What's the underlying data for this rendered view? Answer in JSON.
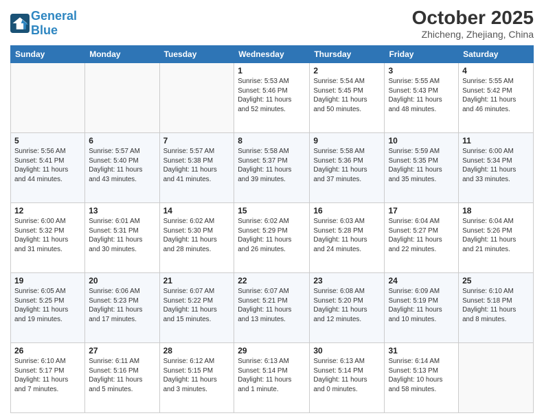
{
  "logo": {
    "text_general": "General",
    "text_blue": "Blue"
  },
  "title": "October 2025",
  "location": "Zhicheng, Zhejiang, China",
  "days_of_week": [
    "Sunday",
    "Monday",
    "Tuesday",
    "Wednesday",
    "Thursday",
    "Friday",
    "Saturday"
  ],
  "weeks": [
    [
      {
        "day": "",
        "info": ""
      },
      {
        "day": "",
        "info": ""
      },
      {
        "day": "",
        "info": ""
      },
      {
        "day": "1",
        "info": "Sunrise: 5:53 AM\nSunset: 5:46 PM\nDaylight: 11 hours\nand 52 minutes."
      },
      {
        "day": "2",
        "info": "Sunrise: 5:54 AM\nSunset: 5:45 PM\nDaylight: 11 hours\nand 50 minutes."
      },
      {
        "day": "3",
        "info": "Sunrise: 5:55 AM\nSunset: 5:43 PM\nDaylight: 11 hours\nand 48 minutes."
      },
      {
        "day": "4",
        "info": "Sunrise: 5:55 AM\nSunset: 5:42 PM\nDaylight: 11 hours\nand 46 minutes."
      }
    ],
    [
      {
        "day": "5",
        "info": "Sunrise: 5:56 AM\nSunset: 5:41 PM\nDaylight: 11 hours\nand 44 minutes."
      },
      {
        "day": "6",
        "info": "Sunrise: 5:57 AM\nSunset: 5:40 PM\nDaylight: 11 hours\nand 43 minutes."
      },
      {
        "day": "7",
        "info": "Sunrise: 5:57 AM\nSunset: 5:38 PM\nDaylight: 11 hours\nand 41 minutes."
      },
      {
        "day": "8",
        "info": "Sunrise: 5:58 AM\nSunset: 5:37 PM\nDaylight: 11 hours\nand 39 minutes."
      },
      {
        "day": "9",
        "info": "Sunrise: 5:58 AM\nSunset: 5:36 PM\nDaylight: 11 hours\nand 37 minutes."
      },
      {
        "day": "10",
        "info": "Sunrise: 5:59 AM\nSunset: 5:35 PM\nDaylight: 11 hours\nand 35 minutes."
      },
      {
        "day": "11",
        "info": "Sunrise: 6:00 AM\nSunset: 5:34 PM\nDaylight: 11 hours\nand 33 minutes."
      }
    ],
    [
      {
        "day": "12",
        "info": "Sunrise: 6:00 AM\nSunset: 5:32 PM\nDaylight: 11 hours\nand 31 minutes."
      },
      {
        "day": "13",
        "info": "Sunrise: 6:01 AM\nSunset: 5:31 PM\nDaylight: 11 hours\nand 30 minutes."
      },
      {
        "day": "14",
        "info": "Sunrise: 6:02 AM\nSunset: 5:30 PM\nDaylight: 11 hours\nand 28 minutes."
      },
      {
        "day": "15",
        "info": "Sunrise: 6:02 AM\nSunset: 5:29 PM\nDaylight: 11 hours\nand 26 minutes."
      },
      {
        "day": "16",
        "info": "Sunrise: 6:03 AM\nSunset: 5:28 PM\nDaylight: 11 hours\nand 24 minutes."
      },
      {
        "day": "17",
        "info": "Sunrise: 6:04 AM\nSunset: 5:27 PM\nDaylight: 11 hours\nand 22 minutes."
      },
      {
        "day": "18",
        "info": "Sunrise: 6:04 AM\nSunset: 5:26 PM\nDaylight: 11 hours\nand 21 minutes."
      }
    ],
    [
      {
        "day": "19",
        "info": "Sunrise: 6:05 AM\nSunset: 5:25 PM\nDaylight: 11 hours\nand 19 minutes."
      },
      {
        "day": "20",
        "info": "Sunrise: 6:06 AM\nSunset: 5:23 PM\nDaylight: 11 hours\nand 17 minutes."
      },
      {
        "day": "21",
        "info": "Sunrise: 6:07 AM\nSunset: 5:22 PM\nDaylight: 11 hours\nand 15 minutes."
      },
      {
        "day": "22",
        "info": "Sunrise: 6:07 AM\nSunset: 5:21 PM\nDaylight: 11 hours\nand 13 minutes."
      },
      {
        "day": "23",
        "info": "Sunrise: 6:08 AM\nSunset: 5:20 PM\nDaylight: 11 hours\nand 12 minutes."
      },
      {
        "day": "24",
        "info": "Sunrise: 6:09 AM\nSunset: 5:19 PM\nDaylight: 11 hours\nand 10 minutes."
      },
      {
        "day": "25",
        "info": "Sunrise: 6:10 AM\nSunset: 5:18 PM\nDaylight: 11 hours\nand 8 minutes."
      }
    ],
    [
      {
        "day": "26",
        "info": "Sunrise: 6:10 AM\nSunset: 5:17 PM\nDaylight: 11 hours\nand 7 minutes."
      },
      {
        "day": "27",
        "info": "Sunrise: 6:11 AM\nSunset: 5:16 PM\nDaylight: 11 hours\nand 5 minutes."
      },
      {
        "day": "28",
        "info": "Sunrise: 6:12 AM\nSunset: 5:15 PM\nDaylight: 11 hours\nand 3 minutes."
      },
      {
        "day": "29",
        "info": "Sunrise: 6:13 AM\nSunset: 5:14 PM\nDaylight: 11 hours\nand 1 minute."
      },
      {
        "day": "30",
        "info": "Sunrise: 6:13 AM\nSunset: 5:14 PM\nDaylight: 11 hours\nand 0 minutes."
      },
      {
        "day": "31",
        "info": "Sunrise: 6:14 AM\nSunset: 5:13 PM\nDaylight: 10 hours\nand 58 minutes."
      },
      {
        "day": "",
        "info": ""
      }
    ]
  ]
}
